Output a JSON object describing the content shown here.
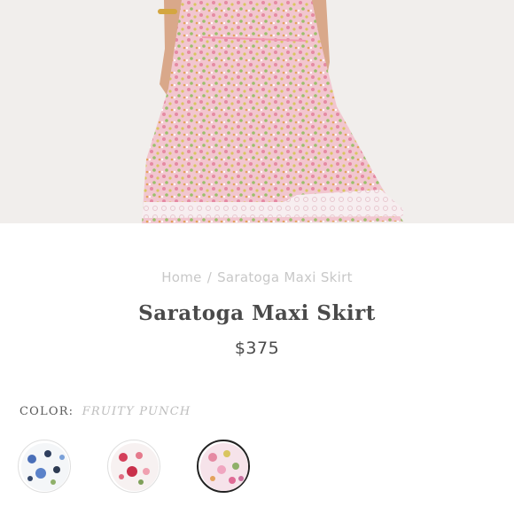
{
  "breadcrumb": {
    "home": "Home",
    "separator": "/",
    "current": "Saratoga Maxi Skirt"
  },
  "product": {
    "title": "Saratoga Maxi Skirt",
    "price": "$375"
  },
  "color": {
    "label": "COLOR:",
    "selected": "FRUITY PUNCH"
  },
  "swatches": [
    {
      "selected": false
    },
    {
      "selected": false
    },
    {
      "selected": true
    }
  ],
  "colors": {
    "text": "#4a4a4a",
    "muted": "#c8c8c8",
    "selected_border": "#222222"
  }
}
